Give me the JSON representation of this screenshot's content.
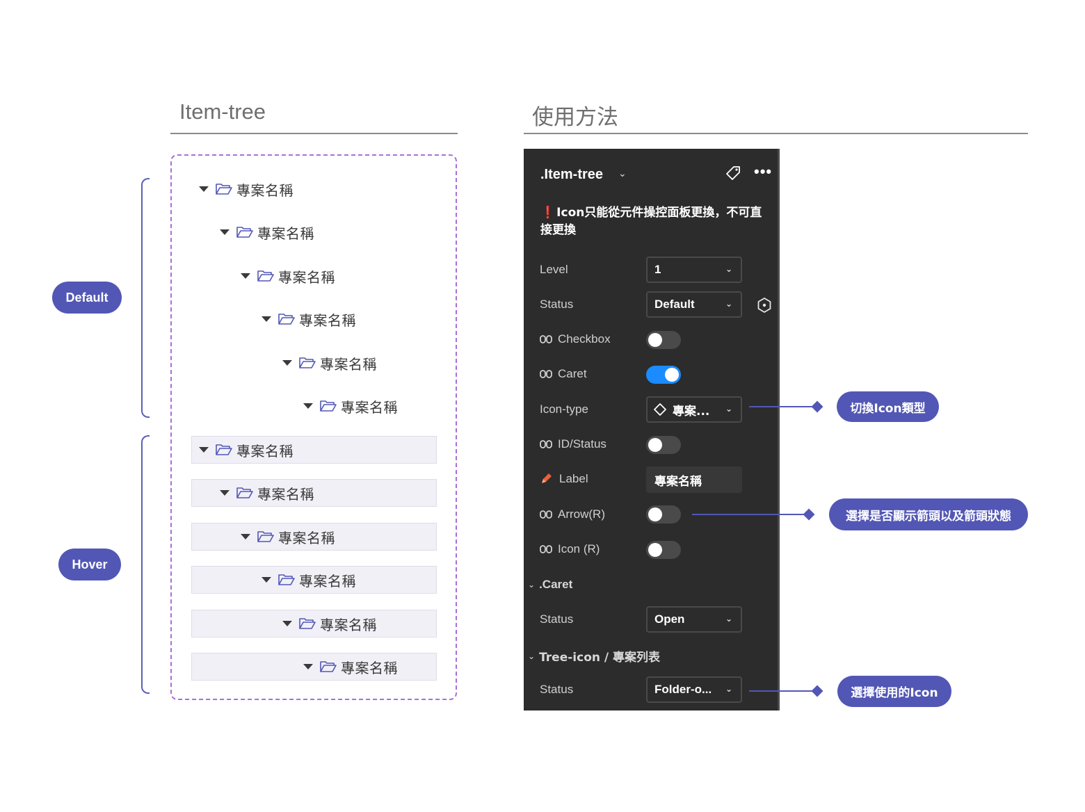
{
  "left_section": {
    "title": "Item-tree",
    "tree_label": "專案名稱",
    "default_pill": "Default",
    "hover_pill": "Hover"
  },
  "right_section": {
    "title": "使用方法"
  },
  "panel": {
    "title": ".Item-tree",
    "warning": "Icon只能從元件操控面板更換，不可直接更換",
    "props": {
      "level_label": "Level",
      "level_value": "1",
      "status_label": "Status",
      "status_value": "Default",
      "checkbox_label": "Checkbox",
      "caret_label": "Caret",
      "icon_type_label": "Icon-type",
      "icon_type_value": "專案...",
      "id_status_label": "ID/Status",
      "label_label": "Label",
      "label_value": "專案名稱",
      "arrow_label": "Arrow(R)",
      "icon_r_label": "Icon (R)"
    },
    "caret_section": {
      "title": ".Caret",
      "status_label": "Status",
      "status_value": "Open"
    },
    "tree_icon_section": {
      "title": "Tree-icon / 專案列表",
      "status_label": "Status",
      "status_value": "Folder-o..."
    },
    "toggles": {
      "checkbox": false,
      "caret": true,
      "id_status": false,
      "arrow": false,
      "icon_r": false
    }
  },
  "annotations": {
    "icon_type": "切換Icon類型",
    "arrow": "選擇是否顯示箭頭以及箭頭狀態",
    "icon_select": "選擇使用的Icon"
  },
  "colors": {
    "accent": "#5257b5",
    "dashed_frame": "#a96fd8",
    "panel_bg": "#2c2c2c",
    "toggle_on": "#1a8cff",
    "hover_row": "#f1f0f7"
  }
}
